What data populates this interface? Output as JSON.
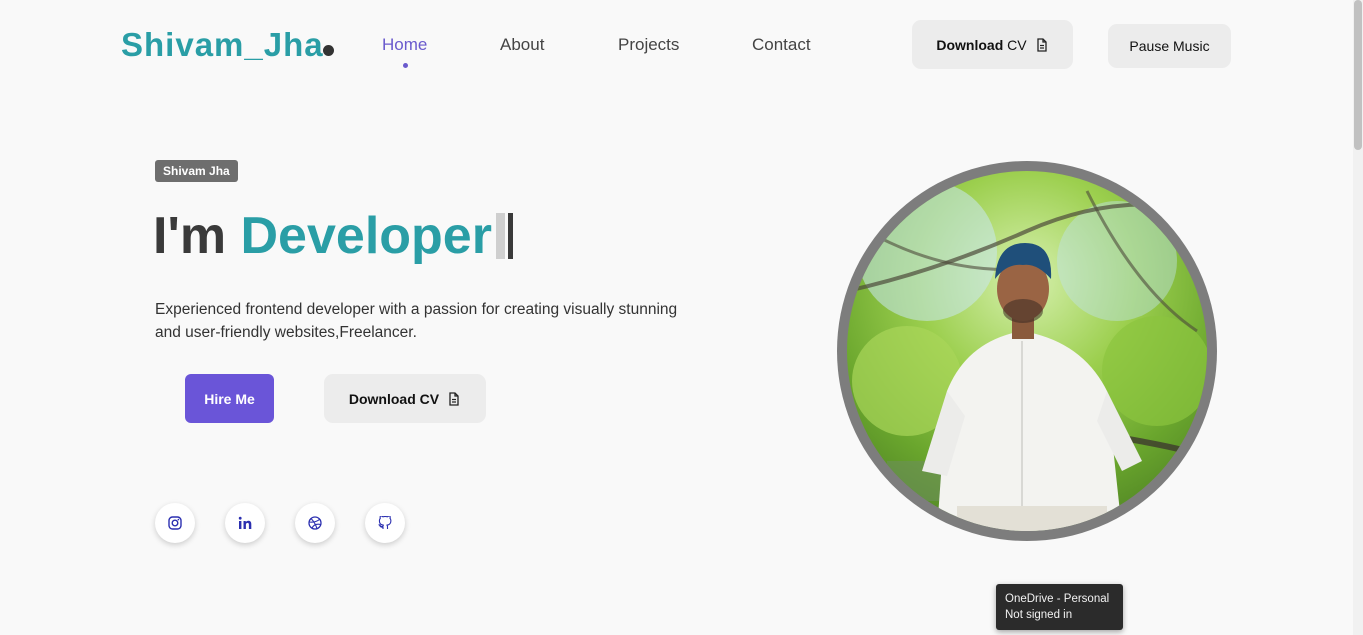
{
  "header": {
    "logo": "Shivam_Jha",
    "nav": [
      {
        "label": "Home",
        "active": true
      },
      {
        "label": "About",
        "active": false
      },
      {
        "label": "Projects",
        "active": false
      },
      {
        "label": "Contact",
        "active": false
      }
    ],
    "download_cv_bold": "Download",
    "download_cv_rest": " CV",
    "pause_music": "Pause Music"
  },
  "hero": {
    "tag": "Shivam Jha",
    "headline_prefix": "I'm ",
    "headline_role": "Developer",
    "description": "Experienced frontend developer with a passion for creating visually stunning and user-friendly websites,Freelancer.",
    "hire_button": "Hire Me",
    "download_button": "Download CV",
    "social_icons": [
      "instagram-icon",
      "linkedin-icon",
      "dribbble-icon",
      "github-icon"
    ]
  },
  "tooltip": {
    "line1": "OneDrive - Personal",
    "line2": "Not signed in"
  },
  "colors": {
    "accent_teal": "#2a9ea6",
    "accent_purple": "#6a55d8",
    "background": "#f9f9f9"
  }
}
